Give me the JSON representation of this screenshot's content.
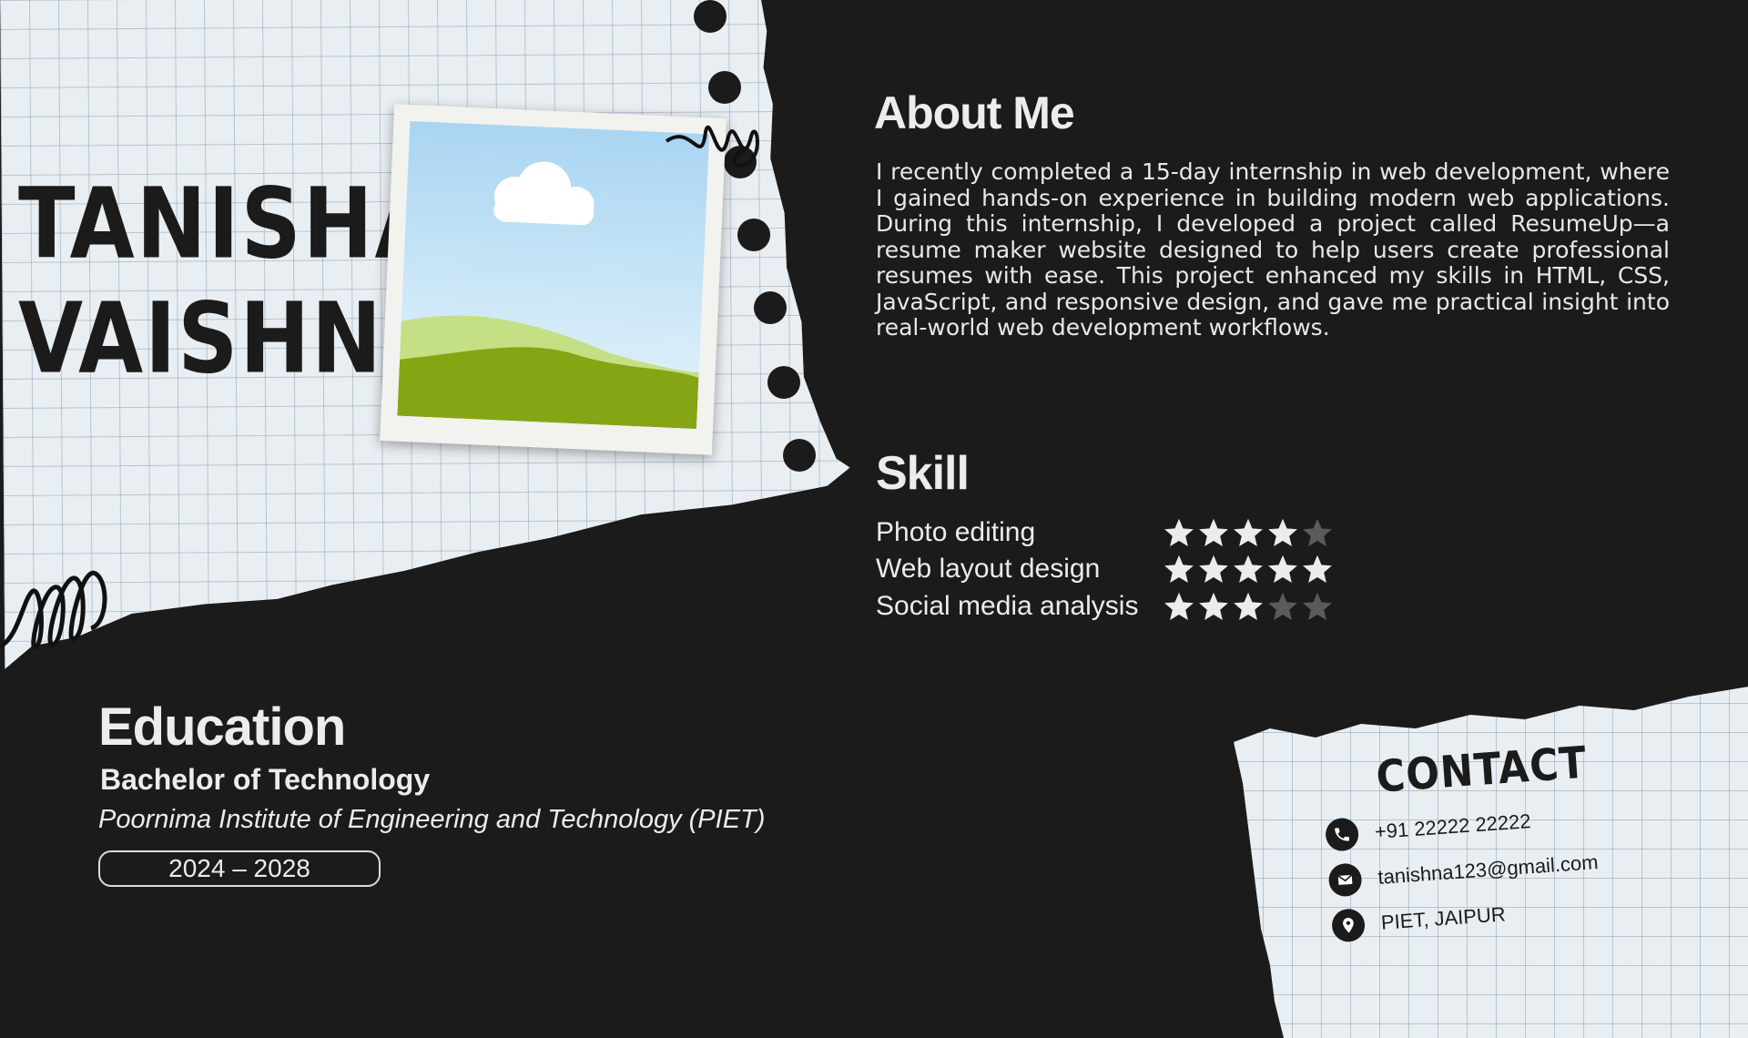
{
  "profile": {
    "first_name": "TANISHA",
    "last_name": "VAISHNAV"
  },
  "about": {
    "title": "About Me",
    "text": "I recently completed a 15-day internship in web development, where I gained hands-on experience in building modern web applications. During this internship, I developed a project called ResumeUp—a resume maker website designed to help users create professional resumes with ease. This project enhanced my skills in HTML, CSS, JavaScript, and responsive design, and gave me practical insight into real-world web development workflows."
  },
  "skills": {
    "title": "Skill",
    "max_rating": 5,
    "items": [
      {
        "label": "Photo editing",
        "rating": 4
      },
      {
        "label": "Web layout design",
        "rating": 5
      },
      {
        "label": "Social media analysis",
        "rating": 3
      }
    ]
  },
  "education": {
    "title": "Education",
    "degree": "Bachelor of Technology",
    "institute": "Poornima Institute of Engineering and Technology (PIET)",
    "years": "2024 – 2028"
  },
  "contact": {
    "title": "CONTACT",
    "items": [
      {
        "icon": "phone-icon",
        "text": "+91 22222 22222"
      },
      {
        "icon": "mail-icon",
        "text": "tanishna123@gmail.com"
      },
      {
        "icon": "location-pin-icon",
        "text": "PIET, JAIPUR"
      }
    ]
  },
  "colors": {
    "background": "#1b1b1b",
    "text_light": "#ececec",
    "star_filled": "#ececec",
    "star_empty": "#5a5a5a",
    "paper": "#e9eef2"
  }
}
